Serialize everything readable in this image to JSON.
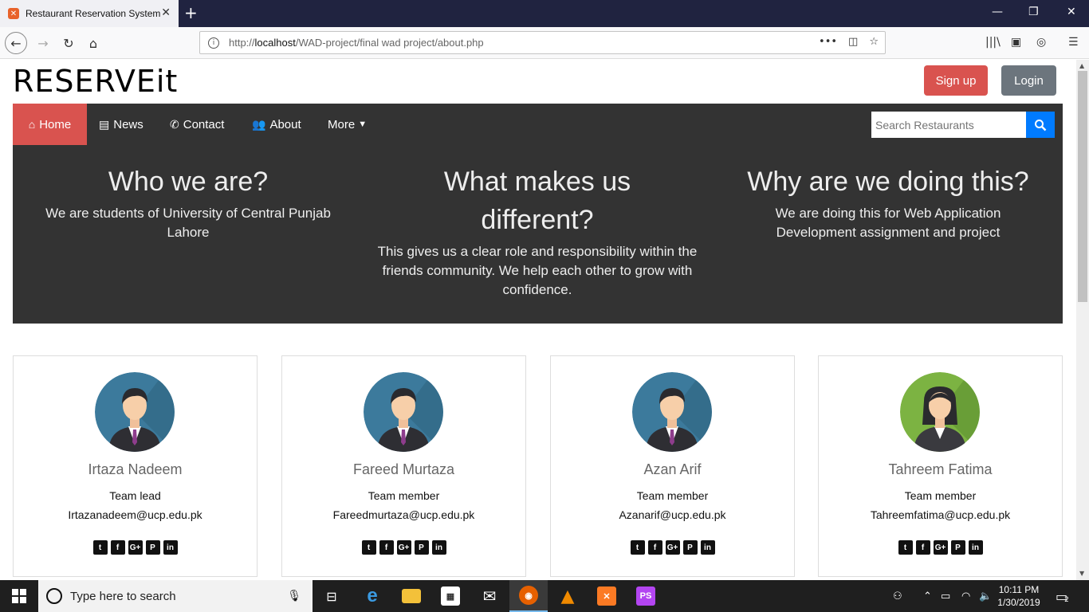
{
  "browser": {
    "tab_title": "Restaurant Reservation System",
    "tab_favicon": "xampp-icon",
    "url_prefix": "http://",
    "url_host": "localhost",
    "url_path": "/WAD-project/final wad project/about.php"
  },
  "header": {
    "brand": "RESERVEit",
    "signup_label": "Sign up",
    "login_label": "Login"
  },
  "nav": {
    "items": [
      {
        "label": "Home",
        "icon": "home-icon"
      },
      {
        "label": "News",
        "icon": "newspaper-icon"
      },
      {
        "label": "Contact",
        "icon": "phone-icon"
      },
      {
        "label": "About",
        "icon": "users-icon"
      },
      {
        "label": "More",
        "icon": "caret-down-icon"
      }
    ],
    "search_placeholder": "Search Restaurants"
  },
  "hero": {
    "cols": [
      {
        "heading": "Who we are?",
        "text": "We are students of University of Central Punjab Lahore"
      },
      {
        "heading": "What makes us different?",
        "text": "This gives us a clear role and responsibility within the friends community. We help each other to grow with confidence."
      },
      {
        "heading": "Why are we doing this?",
        "text": "We are doing this for Web Application Development assignment and project"
      }
    ]
  },
  "team": [
    {
      "name": "Irtaza Nadeem",
      "role": "Team lead",
      "email": "Irtazanadeem@ucp.edu.pk",
      "avatar": "male-avatar-icon"
    },
    {
      "name": "Fareed Murtaza",
      "role": "Team member",
      "email": "Fareedmurtaza@ucp.edu.pk",
      "avatar": "male-avatar-icon"
    },
    {
      "name": "Azan Arif",
      "role": "Team member",
      "email": "Azanarif@ucp.edu.pk",
      "avatar": "male-avatar-icon"
    },
    {
      "name": "Tahreem Fatima",
      "role": "Team member",
      "email": "Tahreemfatima@ucp.edu.pk",
      "avatar": "female-avatar-icon"
    }
  ],
  "taskbar": {
    "search_placeholder": "Type here to search",
    "time": "10:11 PM",
    "date": "1/30/2019",
    "notification_count": "2"
  },
  "colors": {
    "accent_red": "#d9534f",
    "dark_nav": "#333333",
    "search_blue": "#007bff",
    "login_gray": "#6c757d"
  }
}
